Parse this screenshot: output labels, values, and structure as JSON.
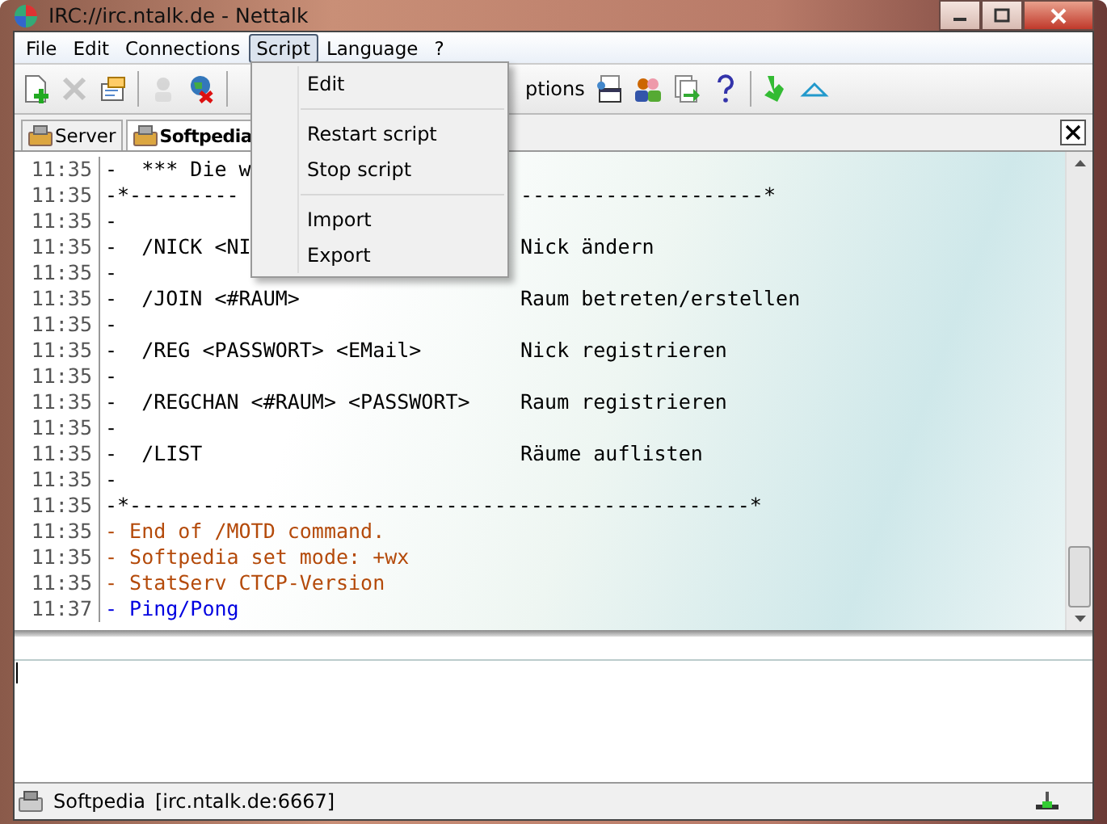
{
  "window": {
    "title": "IRC://irc.ntalk.de  -  Nettalk"
  },
  "menu": [
    {
      "label": "File",
      "selected": false
    },
    {
      "label": "Edit",
      "selected": false
    },
    {
      "label": "Connections",
      "selected": false
    },
    {
      "label": "Script",
      "selected": true
    },
    {
      "label": "Language",
      "selected": false
    },
    {
      "label": "?",
      "selected": false
    }
  ],
  "toolbar_left": [
    {
      "kind": "new",
      "disabled": false
    },
    {
      "kind": "delete",
      "disabled": true
    },
    {
      "kind": "properties",
      "disabled": false
    },
    {
      "kind": "sep"
    },
    {
      "kind": "user",
      "disabled": true
    },
    {
      "kind": "disconnect",
      "disabled": false
    },
    {
      "kind": "sep"
    }
  ],
  "toolbar_label": "ptions",
  "toolbar_right": [
    {
      "kind": "script",
      "disabled": false
    },
    {
      "kind": "users",
      "disabled": false
    },
    {
      "kind": "export",
      "disabled": false
    },
    {
      "kind": "help",
      "disabled": false
    },
    {
      "kind": "sep"
    },
    {
      "kind": "join",
      "disabled": false
    },
    {
      "kind": "up",
      "disabled": false
    }
  ],
  "tabs": [
    {
      "label": "Server",
      "selected": false
    },
    {
      "label": "Softpedia",
      "selected": true
    }
  ],
  "chat": [
    {
      "time": "11:35",
      "kind": "normal",
      "text": "-  *** Die w"
    },
    {
      "time": "11:35",
      "kind": "normal",
      "text": "-*---------",
      "right": "--------------------*"
    },
    {
      "time": "11:35",
      "kind": "normal",
      "text": "-"
    },
    {
      "time": "11:35",
      "kind": "normal",
      "text": "-  /NICK <NI",
      "right": "Nick ändern"
    },
    {
      "time": "11:35",
      "kind": "normal",
      "text": "-"
    },
    {
      "time": "11:35",
      "kind": "normal",
      "text": "-  /JOIN <#RAUM>",
      "right": "Raum betreten/erstellen"
    },
    {
      "time": "11:35",
      "kind": "normal",
      "text": "-"
    },
    {
      "time": "11:35",
      "kind": "normal",
      "text": "-  /REG <PASSWORT> <EMail>",
      "right": "Nick registrieren"
    },
    {
      "time": "11:35",
      "kind": "normal",
      "text": "-"
    },
    {
      "time": "11:35",
      "kind": "normal",
      "text": "-  /REGCHAN <#RAUM> <PASSWORT>",
      "right": "Raum registrieren"
    },
    {
      "time": "11:35",
      "kind": "normal",
      "text": "-"
    },
    {
      "time": "11:35",
      "kind": "normal",
      "text": "-  /LIST",
      "right": "Räume auflisten"
    },
    {
      "time": "11:35",
      "kind": "normal",
      "text": "-"
    },
    {
      "time": "11:35",
      "kind": "normal",
      "text": "-*---------------------------------------------------*"
    },
    {
      "time": "11:35",
      "kind": "server",
      "text": "- End of /MOTD command."
    },
    {
      "time": "11:35",
      "kind": "server",
      "text": "- Softpedia set mode: +wx"
    },
    {
      "time": "11:35",
      "kind": "server",
      "text": "- StatServ CTCP-Version"
    },
    {
      "time": "11:37",
      "kind": "ping",
      "text": "- Ping/Pong"
    }
  ],
  "dropdown": [
    {
      "kind": "item",
      "label": "Edit"
    },
    {
      "kind": "sep"
    },
    {
      "kind": "item",
      "label": "Restart script"
    },
    {
      "kind": "item",
      "label": "Stop script"
    },
    {
      "kind": "sep"
    },
    {
      "kind": "item",
      "label": "Import"
    },
    {
      "kind": "item",
      "label": "Export"
    }
  ],
  "status_bar": {
    "nick": "Softpedia",
    "server": "[irc.ntalk.de:6667]"
  }
}
